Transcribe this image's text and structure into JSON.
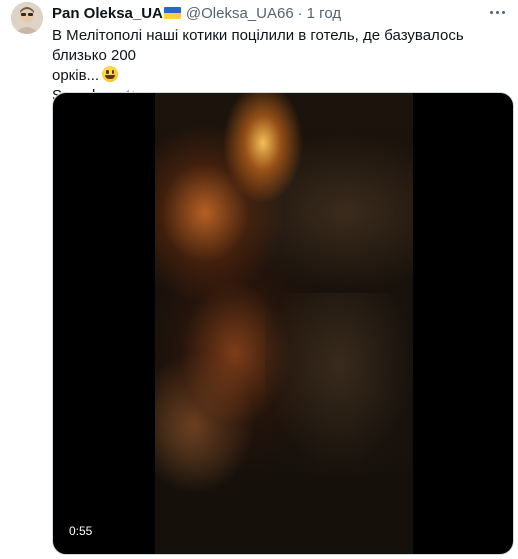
{
  "tweet": {
    "author_name": "Pan Oleksa_UA",
    "author_handle": "@Oleksa_UA66",
    "separator": "·",
    "time_ago": "1 год",
    "flag_icon": "ukraine-flag-icon",
    "text_line1": "В Мелітополі наші котики поцілили в готель, де базувалось близько 200",
    "text_line2": "орків...",
    "emoji_icon": "grinning-face-emoji",
    "sound_label": "Sound on",
    "sound_icon": "speaker-icon"
  },
  "media": {
    "video_duration": "0:55"
  },
  "colors": {
    "text_primary": "#0f1419",
    "text_secondary": "#536471",
    "border": "#cfd9de",
    "flag_blue": "#2a66c4",
    "flag_yellow": "#ffd23b"
  }
}
